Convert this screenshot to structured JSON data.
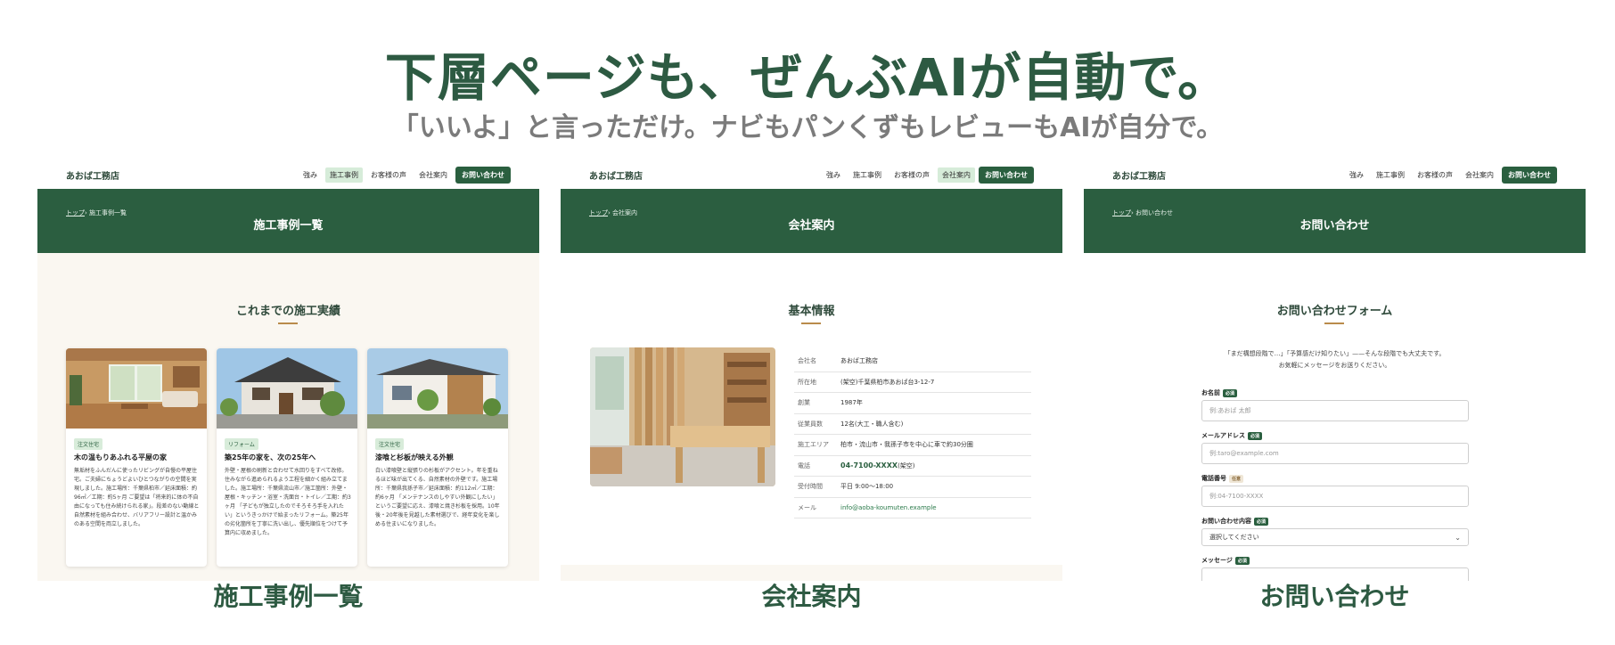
{
  "headline": "下層ページも、ぜんぶAIが自動で。",
  "subline": "「いいよ」と言っただけ。ナビもパンくずもレビューもAIが自分で。",
  "nav": {
    "logo": "あおば工務店",
    "items": [
      "強み",
      "施工事例",
      "お客様の声",
      "会社案内"
    ],
    "cta": "お問い合わせ"
  },
  "crumb_top": "トップ",
  "panels": [
    {
      "crumb": "› 施工事例一覧",
      "hero_title": "施工事例一覧",
      "section_title": "これまでの施工実績",
      "caption": "施工事例一覧",
      "cards": [
        {
          "tag": "注文住宅",
          "title": "木の温もりあふれる平屋の家",
          "desc": "無垢材をふんだんに使ったリビングが自慢の平屋住宅。ご夫婦にちょうどよいひとつながりの空間を実現しました。施工場所：千葉県柏市／延床面積：約96㎡／工期：約5ヶ月 ご要望は「将来的に体の不自由になっても住み続けられる家」。段差のない動線と自然素材を組み合わせ、バリアフリー設計と温かみのある空間を両立しました。"
        },
        {
          "tag": "リフォーム",
          "title": "築25年の家を、次の25年へ",
          "desc": "外壁・屋根の刷新と合わせて水回りをすべて改修。住みながら進められるよう工程を細かく組み立てました。施工場所：千葉県流山市／施工箇所：外壁・屋根・キッチン・浴室・洗面台・トイレ／工期：約3ヶ月 「子どもが独立したのでそろそろ手を入れたい」というきっかけで始まったリフォーム。築25年の劣化箇所を丁寧に洗い出し、優先順位をつけて予算内に収めました。"
        },
        {
          "tag": "注文住宅",
          "title": "漆喰と杉板が映える外観",
          "desc": "白い漆喰壁と縦張りの杉板がアクセント。年を重ねるほど味が出てくる、自然素材の外壁です。施工場所：千葉県我孫子市／延床面積：約112㎡／工期：約6ヶ月 「メンテナンスのしやすい外観にしたい」というご要望に応え、漆喰と焼き杉板を採用。10年後・20年後を見越した素材選びで、経年変化を楽しめる住まいになりました。"
        }
      ]
    },
    {
      "crumb": "› 会社案内",
      "hero_title": "会社案内",
      "section_title": "基本情報",
      "caption": "会社案内",
      "info": [
        {
          "label": "会社名",
          "value": "あおば工務店"
        },
        {
          "label": "所在地",
          "value": "(架空)千葉県柏市あおば台3-12-7"
        },
        {
          "label": "創業",
          "value": "1987年"
        },
        {
          "label": "従業員数",
          "value": "12名(大工・職人含む)"
        },
        {
          "label": "施工エリア",
          "value": "柏市・流山市・我孫子市を中心に車で約30分圏"
        },
        {
          "label": "電話",
          "value": "04-7100-XXXX",
          "note": "(架空)"
        },
        {
          "label": "受付時間",
          "value": "平日 9:00〜18:00"
        },
        {
          "label": "メール",
          "value": "info@aoba-koumuten.example"
        }
      ]
    },
    {
      "crumb": "› お問い合わせ",
      "hero_title": "お問い合わせ",
      "section_title": "お問い合わせフォーム",
      "caption": "お問い合わせ",
      "intro_line1": "「まだ構想段階で…」「予算感だけ知りたい」——そんな段階でも大丈夫です。",
      "intro_line2": "お気軽にメッセージをお送りください。",
      "required_badge": "必須",
      "optional_badge": "任意",
      "fields": {
        "name": {
          "label": "お名前",
          "placeholder": "例:あおば 太郎"
        },
        "email": {
          "label": "メールアドレス",
          "placeholder": "例:taro@example.com"
        },
        "phone": {
          "label": "電話番号",
          "placeholder": "例:04-7100-XXXX"
        },
        "topic": {
          "label": "お問い合わせ内容",
          "value": "選択してください"
        },
        "message": {
          "label": "メッセージ"
        }
      }
    }
  ],
  "colors": {
    "brand_green": "#2b5e40",
    "accent_gold": "#b98b4b",
    "beige_bg": "#faf7f1"
  }
}
